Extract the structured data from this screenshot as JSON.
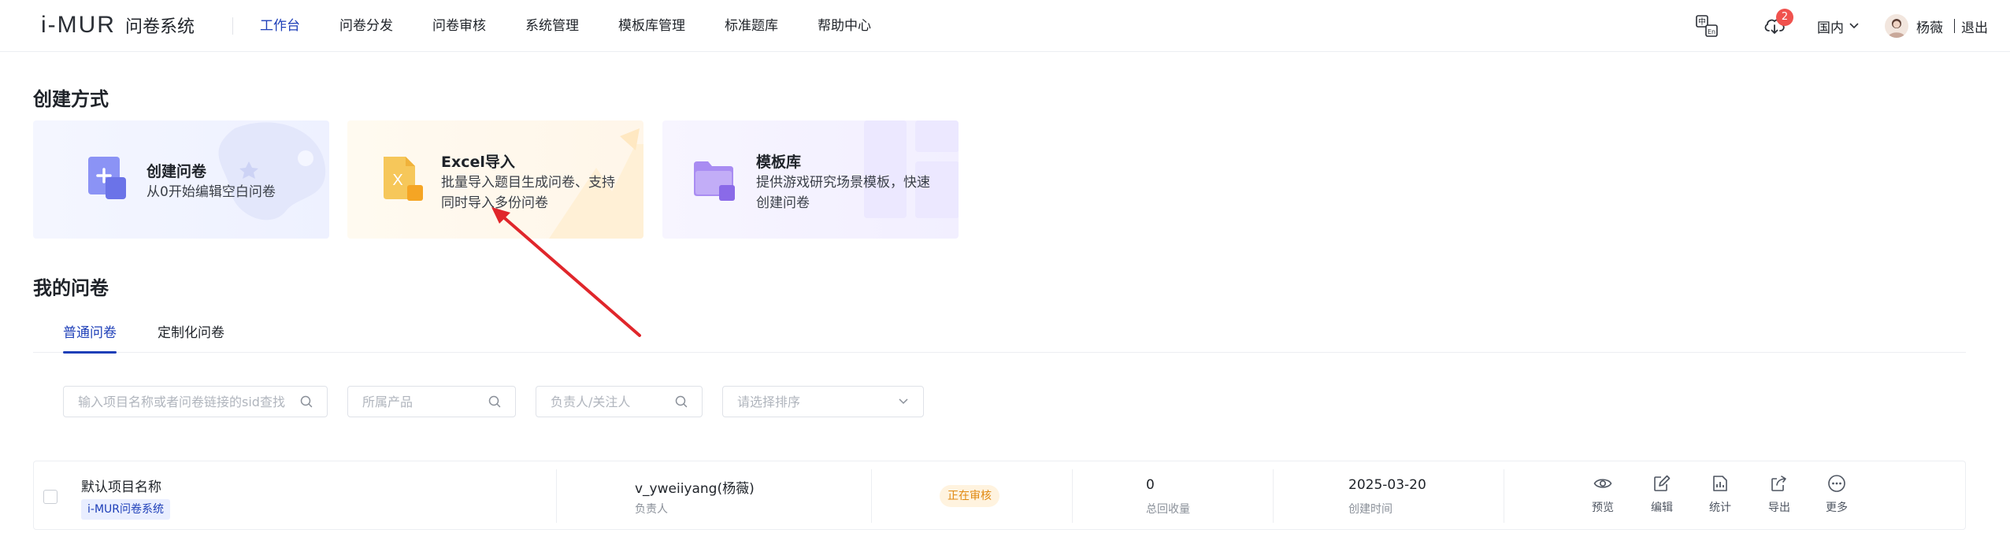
{
  "header": {
    "logo_mark": "i-MUR",
    "logo_text": "问卷系统",
    "nav": [
      {
        "label": "工作台",
        "active": true
      },
      {
        "label": "问卷分发",
        "active": false
      },
      {
        "label": "问卷审核",
        "active": false
      },
      {
        "label": "系统管理",
        "active": false
      },
      {
        "label": "模板库管理",
        "active": false
      },
      {
        "label": "标准题库",
        "active": false
      },
      {
        "label": "帮助中心",
        "active": false
      }
    ],
    "language_icon": "translate-icon",
    "download_icon": "cloud-download-icon",
    "download_badge": "2",
    "region": "国内",
    "user_name": "杨薇",
    "logout": "退出"
  },
  "create": {
    "title": "创建方式",
    "cards": [
      {
        "title": "创建问卷",
        "desc": "从0开始编辑空白问卷",
        "icon": "add-document-icon"
      },
      {
        "title": "Excel导入",
        "desc": "批量导入题目生成问卷、支持同时导入多份问卷",
        "icon": "excel-file-icon"
      },
      {
        "title": "模板库",
        "desc": "提供游戏研究场景模板，快速创建问卷",
        "icon": "folder-icon"
      }
    ]
  },
  "my": {
    "title": "我的问卷",
    "tabs": [
      {
        "label": "普通问卷",
        "active": true
      },
      {
        "label": "定制化问卷",
        "active": false
      }
    ],
    "filters": {
      "search_placeholder": "输入项目名称或者问卷链接的sid查找",
      "product_placeholder": "所属产品",
      "owner_placeholder": "负责人/关注人",
      "sort_placeholder": "请选择排序"
    },
    "rows": [
      {
        "project": "默认项目名称",
        "tag": "i-MUR问卷系统",
        "owner": "v_yweiiyang(杨薇)",
        "owner_label": "负责人",
        "status": "正在审核",
        "count": "0",
        "count_label": "总回收量",
        "date": "2025-03-20",
        "date_label": "创建时间",
        "actions": [
          {
            "label": "预览",
            "icon": "eye-icon"
          },
          {
            "label": "编辑",
            "icon": "edit-icon"
          },
          {
            "label": "统计",
            "icon": "chart-icon"
          },
          {
            "label": "导出",
            "icon": "export-icon"
          },
          {
            "label": "更多",
            "icon": "more-icon"
          }
        ]
      }
    ]
  },
  "colors": {
    "accent": "#1e3fb8",
    "annotation_arrow": "#e0262b",
    "status_warning": "#e08a12"
  }
}
